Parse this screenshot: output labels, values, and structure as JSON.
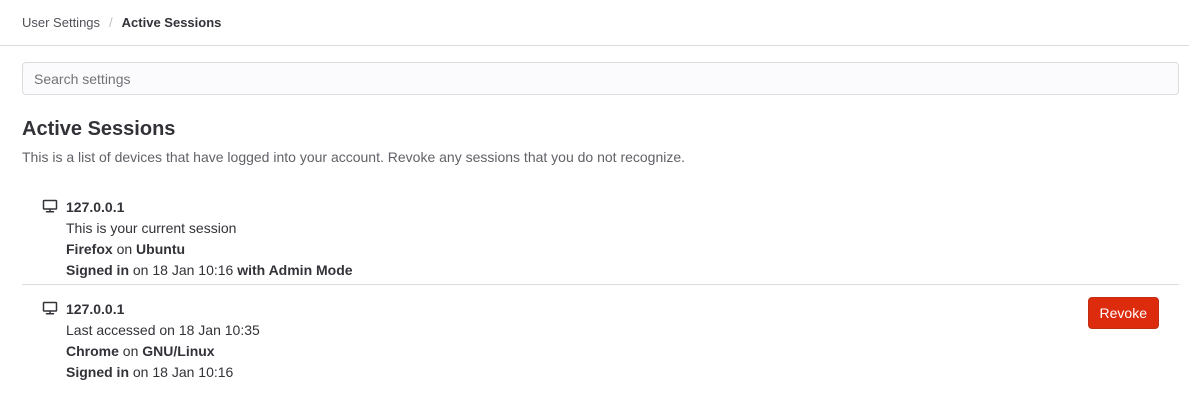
{
  "breadcrumb": {
    "parent": "User Settings",
    "separator": "/",
    "current": "Active Sessions"
  },
  "search": {
    "placeholder": "Search settings",
    "value": ""
  },
  "page": {
    "title": "Active Sessions",
    "description": "This is a list of devices that have logged into your account. Revoke any sessions that you do not recognize."
  },
  "sessions": [
    {
      "icon": "desktop-icon",
      "ip": "127.0.0.1",
      "status": "This is your current session",
      "browser": "Firefox",
      "on_word": "on",
      "os": "Ubuntu",
      "signed_in_label": "Signed in",
      "signed_in_time": "on 18 Jan 10:16",
      "mode": "with Admin Mode"
    },
    {
      "icon": "desktop-icon",
      "ip": "127.0.0.1",
      "status": "Last accessed on 18 Jan 10:35",
      "browser": "Chrome",
      "on_word": "on",
      "os": "GNU/Linux",
      "signed_in_label": "Signed in",
      "signed_in_time": "on 18 Jan 10:16",
      "revoke_label": "Revoke"
    }
  ],
  "colors": {
    "revoke_button": "#dd2b0e",
    "border": "#dcdcde",
    "text": "#333238"
  }
}
